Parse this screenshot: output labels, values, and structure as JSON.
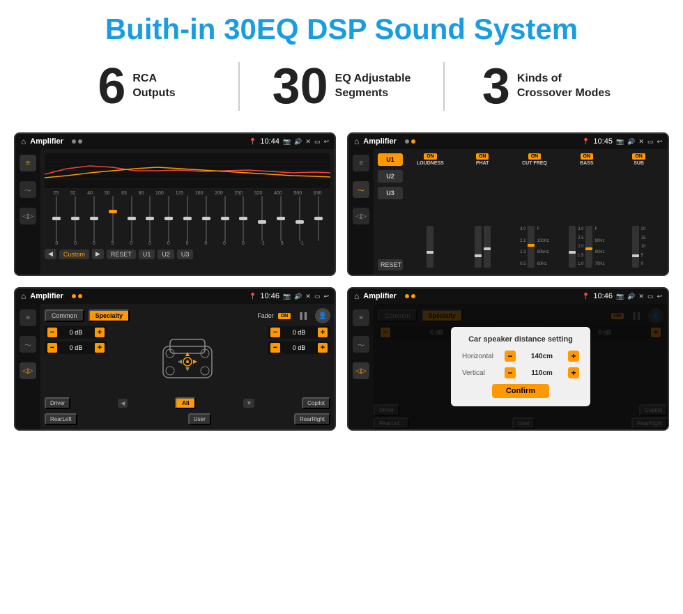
{
  "header": {
    "title": "Buith-in 30EQ DSP Sound System"
  },
  "stats": [
    {
      "number": "6",
      "label_line1": "RCA",
      "label_line2": "Outputs"
    },
    {
      "number": "30",
      "label_line1": "EQ Adjustable",
      "label_line2": "Segments"
    },
    {
      "number": "3",
      "label_line1": "Kinds of",
      "label_line2": "Crossover Modes"
    }
  ],
  "screen1": {
    "status_bar": {
      "title": "Amplifier",
      "time": "10:44"
    },
    "freq_labels": [
      "25",
      "32",
      "40",
      "50",
      "63",
      "80",
      "100",
      "125",
      "160",
      "200",
      "250",
      "320",
      "400",
      "500",
      "630"
    ],
    "slider_values": [
      "0",
      "0",
      "0",
      "5",
      "0",
      "0",
      "0",
      "0",
      "0",
      "0",
      "0",
      "-1",
      "0",
      "-1"
    ],
    "bottom_buttons": [
      "Custom",
      "RESET",
      "U1",
      "U2",
      "U3"
    ]
  },
  "screen2": {
    "status_bar": {
      "title": "Amplifier",
      "time": "10:45"
    },
    "u_buttons": [
      "U1",
      "U2",
      "U3"
    ],
    "channels": [
      {
        "name": "LOUDNESS",
        "on": true
      },
      {
        "name": "PHAT",
        "on": true
      },
      {
        "name": "CUT FREQ",
        "on": true
      },
      {
        "name": "BASS",
        "on": true
      },
      {
        "name": "SUB",
        "on": true
      }
    ],
    "reset_label": "RESET"
  },
  "screen3": {
    "status_bar": {
      "title": "Amplifier",
      "time": "10:46"
    },
    "tabs": [
      "Common",
      "Specialty"
    ],
    "fader_label": "Fader",
    "on_badge": "ON",
    "db_values": [
      "0 dB",
      "0 dB",
      "0 dB",
      "0 dB"
    ],
    "buttons": {
      "driver": "Driver",
      "copilot": "Copilot",
      "rear_left": "RearLeft",
      "all": "All",
      "user": "User",
      "rear_right": "RearRight"
    }
  },
  "screen4": {
    "status_bar": {
      "title": "Amplifier",
      "time": "10:46"
    },
    "tabs": [
      "Common",
      "Specialty"
    ],
    "on_badge": "ON",
    "dialog": {
      "title": "Car speaker distance setting",
      "horizontal_label": "Horizontal",
      "horizontal_value": "140cm",
      "vertical_label": "Vertical",
      "vertical_value": "110cm",
      "confirm_label": "Confirm"
    },
    "db_values": [
      "0 dB",
      "0 dB"
    ],
    "buttons": {
      "driver": "Driver",
      "copilot": "Copilot",
      "rear_left": "RearLef...",
      "user": "User",
      "rear_right": "RearRight"
    }
  },
  "icons": {
    "home": "⌂",
    "pin": "📍",
    "camera": "📷",
    "volume": "🔊",
    "back": "↩",
    "eq_icon": "⚙",
    "wave_icon": "〰",
    "speaker_icon": "🔈"
  }
}
